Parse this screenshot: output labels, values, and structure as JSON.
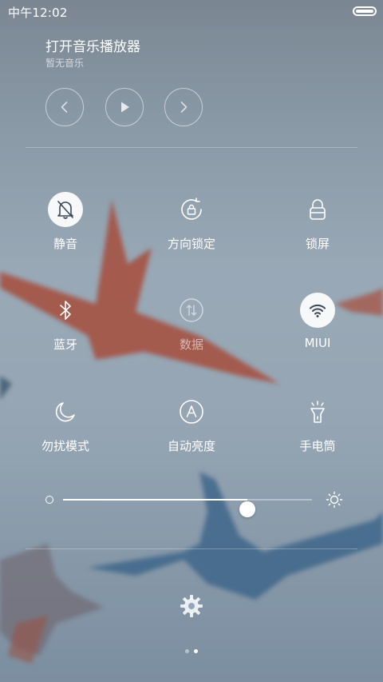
{
  "status_bar": {
    "time": "中午12:02"
  },
  "music": {
    "title": "打开音乐播放器",
    "subtitle": "暂无音乐",
    "controls": {
      "prev_icon": "chevron-left-icon",
      "play_icon": "play-icon",
      "next_icon": "chevron-right-icon"
    }
  },
  "toggles": [
    {
      "label": "静音",
      "icon": "bell-off-icon",
      "active": true
    },
    {
      "label": "方向锁定",
      "icon": "rotation-lock-icon",
      "active": false
    },
    {
      "label": "锁屏",
      "icon": "lock-icon",
      "active": false
    },
    {
      "label": "蓝牙",
      "icon": "bluetooth-icon",
      "active": false
    },
    {
      "label": "数据",
      "icon": "mobile-data-icon",
      "active": false,
      "disabled": true
    },
    {
      "label": "MIUI",
      "icon": "wifi-icon",
      "active": true
    },
    {
      "label": "勿扰模式",
      "icon": "moon-icon",
      "active": false
    },
    {
      "label": "自动亮度",
      "icon": "auto-brightness-icon",
      "active": false
    },
    {
      "label": "手电筒",
      "icon": "flashlight-icon",
      "active": false
    }
  ],
  "brightness": {
    "level": 0.74,
    "min_icon": "brightness-low-icon",
    "max_icon": "brightness-high-icon"
  },
  "settings": {
    "icon": "gear-icon"
  },
  "pager": {
    "count": 2,
    "active_index": 1
  },
  "colors": {
    "active_circle": "#ffffff",
    "icon_on_active": "#3b4b5a"
  }
}
